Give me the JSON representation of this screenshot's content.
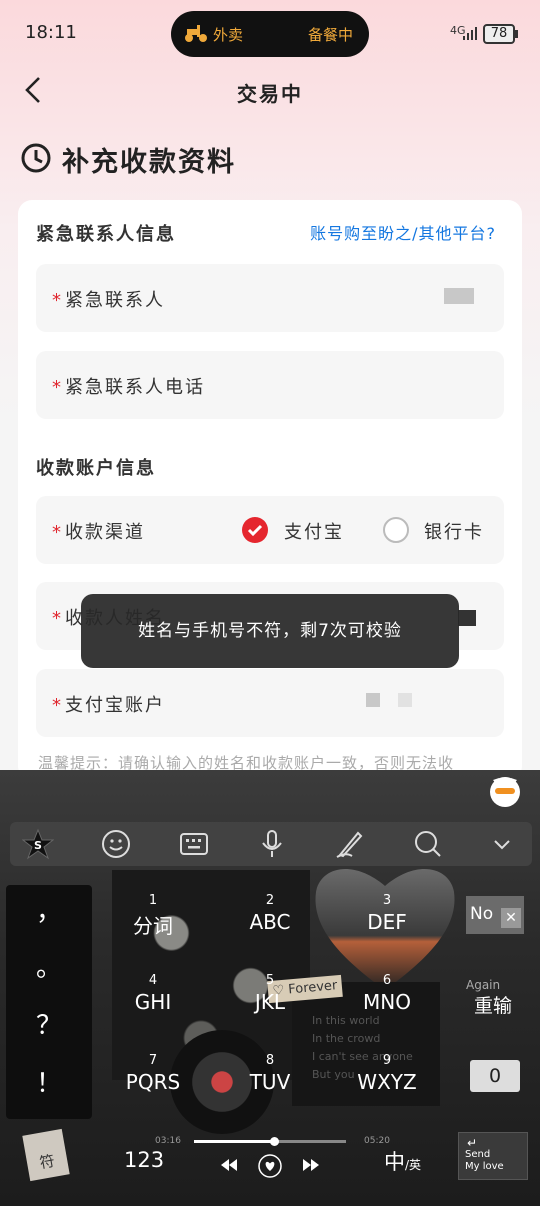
{
  "status_bar": {
    "time": "18:11",
    "delivery_label": "外卖",
    "order_status": "备餐中",
    "network": "4G",
    "battery": "78"
  },
  "nav": {
    "title": "交易中"
  },
  "section": {
    "title": "补充收款资料"
  },
  "emergency": {
    "title": "紧急联系人信息",
    "help_link": "账号购至盼之/其他平台?",
    "contact_label": "紧急联系人",
    "phone_label": "紧急联系人电话"
  },
  "account": {
    "title": "收款账户信息",
    "channel_label": "收款渠道",
    "option_alipay": "支付宝",
    "option_bank": "银行卡",
    "name_label": "收款人姓名",
    "alipay_label": "支付宝账户"
  },
  "required_mark": "*",
  "tip": "温馨提示：请确认输入的姓名和收款账户一致，否则无法收",
  "toast": "姓名与手机号不符，剩7次可校验",
  "colors": {
    "accent": "#e5262e",
    "link": "#1477e0",
    "pill_text": "#f0a93a"
  },
  "keyboard": {
    "left_punct": [
      "，",
      "。",
      "？",
      "！"
    ],
    "keys": [
      {
        "num": "1",
        "label": "分词"
      },
      {
        "num": "2",
        "label": "ABC"
      },
      {
        "num": "3",
        "label": "DEF"
      },
      {
        "num": "4",
        "label": "GHI"
      },
      {
        "num": "5",
        "label": "JKL"
      },
      {
        "num": "6",
        "label": "MNO"
      },
      {
        "num": "7",
        "label": "PQRS"
      },
      {
        "num": "8",
        "label": "TUV"
      },
      {
        "num": "9",
        "label": "WXYZ"
      }
    ],
    "no_tag": "No",
    "forever": "♡ Forever",
    "lyrics": [
      "In this world",
      "In the crowd",
      "I can't see anyone",
      "But you"
    ],
    "again": "Again",
    "retype": "重输",
    "zero": "0",
    "symbols": "符",
    "num123": "123",
    "time_start": "03:16",
    "time_end": "05:20",
    "cn_en": "中",
    "cn_en_sub": "/英",
    "send": "Send",
    "my_love": "My love",
    "enter_icon": "↵"
  }
}
